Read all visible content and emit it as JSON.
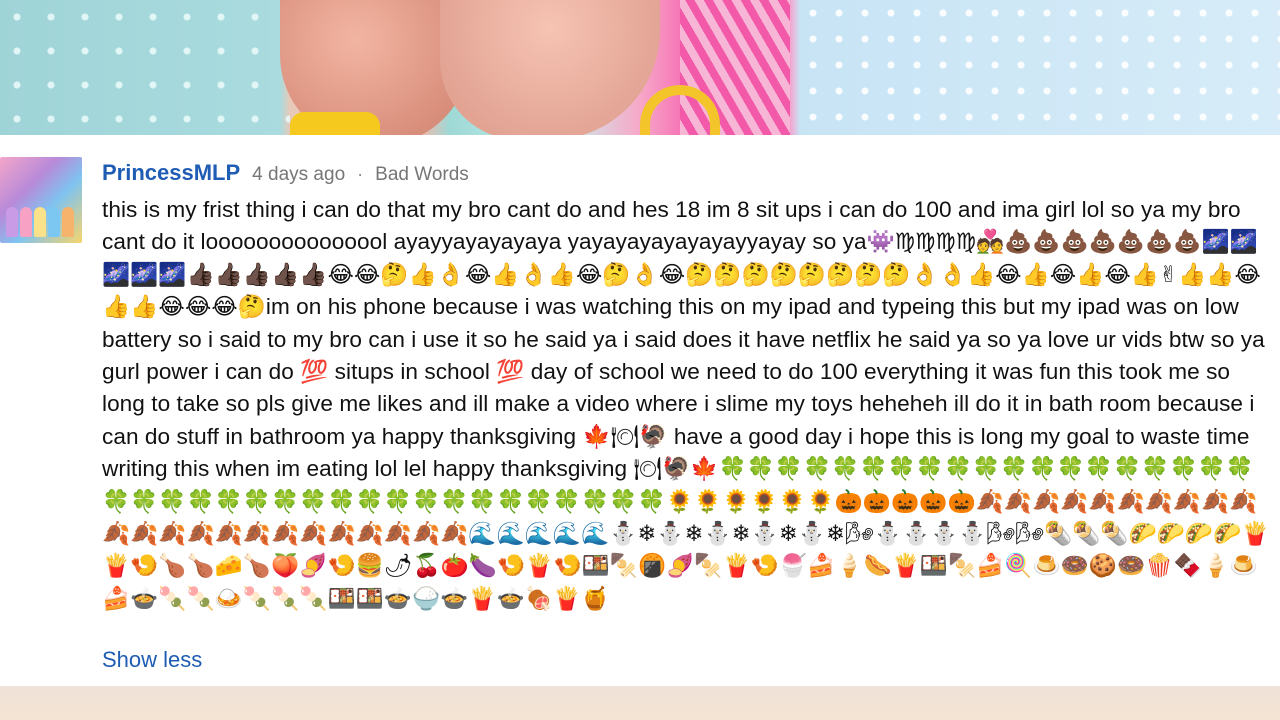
{
  "comment": {
    "author": "PrincessMLP",
    "time": "4 days ago",
    "separator": "·",
    "flag_label": "Bad Words",
    "text": "this is my frist thing i can do that my bro cant do and hes 18 im 8 sit ups i can do 100 and ima girl lol so ya my bro cant do it looooooooooooool ayayyayayayaya yayayayayayayayyayay so ya👾♍♍♍♍💑💩💩💩💩💩💩💩🌌🌌🌌🌌🌌👍🏿👍🏿👍🏿👍🏿👍🏿😂😂🤔👍👌😂👍👌👍😂🤔👌😂🤔🤔🤔🤔🤔🤔🤔🤔👌👌👍😂👍😂👍😂👍✌👍👍😂👍👍😂😂😂🤔im on his phone because i was watching this on my ipad and typeing this but my ipad was on low battery so i said to my bro can i use it so he said ya i said does it have netflix he said ya so ya love ur vids btw so ya gurl power i can do 💯 situps in school 💯 day of school we need to do 100 everything it was fun this took me so long to take so pls give me likes and ill make a video where i slime my toys heheheh ill do it in bath room because i can do stuff in bathroom ya happy thanksgiving 🍁🍽🦃 have a good day i hope this is long my goal to waste time writing this when im eating lol lel happy thanksgiving 🍽🦃🍁🍀🍀🍀🍀🍀🍀🍀🍀🍀🍀🍀🍀🍀🍀🍀🍀🍀🍀🍀🍀🍀🍀🍀🍀🍀🍀🍀🍀🍀🍀🍀🍀🍀🍀🍀🍀🍀🍀🍀🌻🌻🌻🌻🌻🌻🎃🎃🎃🎃🎃🍂🍂🍂🍂🍂🍂🍂🍂🍂🍂🍂🍂🍂🍂🍂🍂🍂🍂🍂🍂🍂🍂🍂🌊🌊🌊🌊🌊⛄❄⛄❄⛄❄⛄❄⛄❄🌬⛄⛄⛄⛄🌬🌬🌯🌯🌯🌮🌮🌮🌮🍟🍟🍤🍗🍗🧀🍗🍑🍠🍤🍔🌶🍒🍅🍆🍤🍟🍤🍱🍢🍘🍠🍢🍟🍤🍧🍰🍦🌭🍟🍱🍢🍰🍭🍮🍩🍪🍩🍿🍫🍦🍮🍰🍲🍡🍡🍛🍡🍡🍡🍱🍱🍲🍚🍲🍟🍲🍖🍟🍯",
    "show_less_label": "Show less"
  },
  "icons": {
    "avatar": "my-little-pony-avatar"
  }
}
